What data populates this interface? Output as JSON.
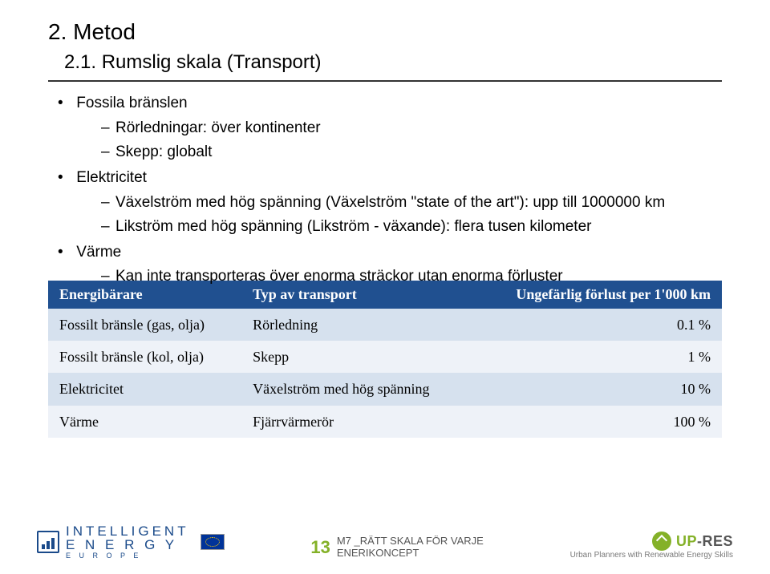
{
  "heading_main": "2. Metod",
  "heading_sub": "2.1. Rumslig skala (Transport)",
  "bullets": {
    "b1": "Fossila bränslen",
    "b1_s1": "Rörledningar: över kontinenter",
    "b1_s2": "Skepp: globalt",
    "b2": "Elektricitet",
    "b2_s1": "Växelström med hög spänning (Växelström \"state of the art\"): upp till 1000000 km",
    "b2_s2": "Likström med hög spänning (Likström  - växande): flera tusen kilometer",
    "b3": "Värme",
    "b3_s1": "Kan inte transporteras över enorma sträckor utan enorma förluster"
  },
  "table": {
    "headers": {
      "h1": "Energibärare",
      "h2": "Typ av transport",
      "h3": "Ungefärlig förlust per 1'000 km"
    },
    "rows": [
      {
        "c1": "Fossilt bränsle (gas, olja)",
        "c2": "Rörledning",
        "c3": "0.1 %"
      },
      {
        "c1": "Fossilt bränsle (kol, olja)",
        "c2": "Skepp",
        "c3": "1 %"
      },
      {
        "c1": "Elektricitet",
        "c2": "Växelström med hög spänning",
        "c3": "10 %"
      },
      {
        "c1": "Värme",
        "c2": "Fjärrvärmerör",
        "c3": "100 %"
      }
    ]
  },
  "footer": {
    "intelligent_line1": "INTELLIGENT",
    "intelligent_line2": "E N E R G Y",
    "intelligent_sub": "E  U  R  O  P  E",
    "page_number": "13",
    "subtitle_line1": "M7 _RÄTT SKALA FÖR VARJE",
    "subtitle_line2": "ENERIKONCEPT",
    "upres_up": "UP",
    "upres_sep": "-",
    "upres_res": "RES",
    "upres_sub": "Urban Planners with Renewable Energy Skills"
  }
}
